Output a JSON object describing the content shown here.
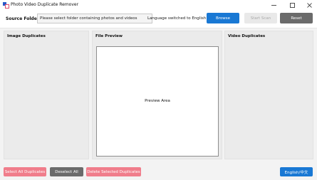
{
  "window": {
    "title": "Photo Video Duplicate Remover",
    "controls": {
      "minimize": "minimize-icon",
      "maximize": "maximize-icon",
      "close": "close-icon"
    },
    "app_icon": "app-logo-icon"
  },
  "toolbar": {
    "source_label": "Source Folder:",
    "folder_value": "Please select folder containing photos and videos",
    "status": "Language switched to English",
    "browse_label": "Browse",
    "start_scan_label": "Start Scan",
    "reset_label": "Reset"
  },
  "panels": {
    "image_title": "Image Duplicates",
    "preview_title": "File Preview",
    "preview_placeholder": "Preview Area",
    "video_title": "Video Duplicates"
  },
  "footer": {
    "select_all_label": "Select All Duplicates",
    "deselect_all_label": "Deselect All",
    "delete_selected_label": "Delete Selected Duplicates",
    "language_label": "English/中文"
  },
  "colors": {
    "primary": "#1978d4",
    "danger": "#f07d8b",
    "neutral": "#6b6b6b",
    "disabled": "#e9e9e9"
  }
}
